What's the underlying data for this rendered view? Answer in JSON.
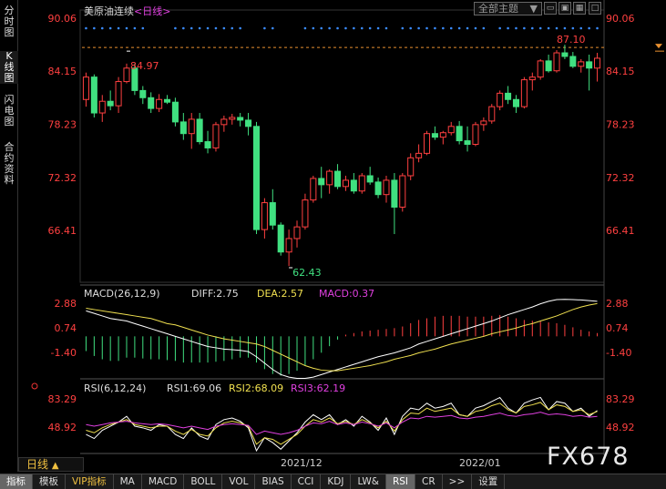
{
  "sidebar": {
    "tabs": [
      {
        "label": "分时图",
        "active": false
      },
      {
        "label": "K线图",
        "active": true
      },
      {
        "label": "闪电图",
        "active": false
      },
      {
        "label": "合约资料",
        "active": false
      }
    ]
  },
  "header": {
    "symbol": "美原油连续",
    "period_tag": "<日线>",
    "theme_select": "全部主题",
    "theme_arrow": "▼"
  },
  "price_axis": {
    "ticks": [
      "90.06",
      "84.15",
      "78.23",
      "72.32",
      "66.41"
    ]
  },
  "annotations": {
    "high_left": "84.97",
    "high_right": "87.10",
    "low": "62.43"
  },
  "macd": {
    "title": "MACD(26,12,9)",
    "diff": "DIFF:2.75",
    "dea": "DEA:2.57",
    "macd": "MACD:0.37",
    "ticks": [
      "2.88",
      "0.74",
      "-1.40"
    ]
  },
  "rsi": {
    "title": "RSI(6,12,24)",
    "rsi1": "RSI1:69.06",
    "rsi2": "RSI2:68.09",
    "rsi3": "RSI3:62.19",
    "ticks": [
      "83.29",
      "48.92"
    ]
  },
  "time_axis": [
    "2021/12",
    "2022/01"
  ],
  "period_box": {
    "label": "日线",
    "arrow": "▲"
  },
  "bottom_tabs": [
    {
      "label": "指标",
      "active": true
    },
    {
      "label": "模板",
      "active": false
    },
    {
      "label": "VIP指标",
      "active": false,
      "vip": true
    },
    {
      "label": "MA",
      "active": false
    },
    {
      "label": "MACD",
      "active": false
    },
    {
      "label": "BOLL",
      "active": false
    },
    {
      "label": "VOL",
      "active": false
    },
    {
      "label": "BIAS",
      "active": false
    },
    {
      "label": "CCI",
      "active": false
    },
    {
      "label": "KDJ",
      "active": false
    },
    {
      "label": "LW&",
      "active": false
    },
    {
      "label": "RSI",
      "active": true
    },
    {
      "label": "CR",
      "active": false
    },
    {
      "label": ">>",
      "active": false
    },
    {
      "label": "设置",
      "active": false
    }
  ],
  "watermark": "FX678",
  "colors": {
    "up": "#ff4040",
    "down": "#40e080",
    "diff_line": "#ffffff",
    "dea_line": "#f0e050",
    "macd_label": "#e040e0",
    "rsi3_line": "#e040e0",
    "axis_text": "#ff4040"
  },
  "candles": [
    [
      81.0,
      84.0,
      80.2,
      83.5
    ],
    [
      83.5,
      83.8,
      79.0,
      79.5
    ],
    [
      79.5,
      81.5,
      78.5,
      80.8
    ],
    [
      80.8,
      82.0,
      79.8,
      80.3
    ],
    [
      80.3,
      83.5,
      79.5,
      83.0
    ],
    [
      83.0,
      85.0,
      82.8,
      84.5
    ],
    [
      84.5,
      85.0,
      81.5,
      82.0
    ],
    [
      82.0,
      82.5,
      80.5,
      81.2
    ],
    [
      81.2,
      81.8,
      79.5,
      80.0
    ],
    [
      80.0,
      81.6,
      79.6,
      81.0
    ],
    [
      81.0,
      81.5,
      80.5,
      80.7
    ],
    [
      80.7,
      81.2,
      78.0,
      78.5
    ],
    [
      78.5,
      79.5,
      76.5,
      77.2
    ],
    [
      77.2,
      79.5,
      75.5,
      78.8
    ],
    [
      78.8,
      79.5,
      76.0,
      76.3
    ],
    [
      76.3,
      77.5,
      75.0,
      75.6
    ],
    [
      75.6,
      78.5,
      75.2,
      78.2
    ],
    [
      78.2,
      79.2,
      77.4,
      78.8
    ],
    [
      78.8,
      79.4,
      78.2,
      79.0
    ],
    [
      79.0,
      79.5,
      78.0,
      78.7
    ],
    [
      78.7,
      79.5,
      77.0,
      78.0
    ],
    [
      78.0,
      78.5,
      66.0,
      66.5
    ],
    [
      66.5,
      70.0,
      65.5,
      69.5
    ],
    [
      69.5,
      71.0,
      66.5,
      67.0
    ],
    [
      67.0,
      67.3,
      63.6,
      64.0
    ],
    [
      64.0,
      66.5,
      62.43,
      65.5
    ],
    [
      65.5,
      67.5,
      64.5,
      66.8
    ],
    [
      66.8,
      70.5,
      66.5,
      69.8
    ],
    [
      69.8,
      72.5,
      69.5,
      72.2
    ],
    [
      72.2,
      73.5,
      70.0,
      71.5
    ],
    [
      71.5,
      73.2,
      70.5,
      73.0
    ],
    [
      73.0,
      73.8,
      71.0,
      71.3
    ],
    [
      71.3,
      72.5,
      70.8,
      72.0
    ],
    [
      72.0,
      72.8,
      70.5,
      70.8
    ],
    [
      70.8,
      72.8,
      70.5,
      72.5
    ],
    [
      72.5,
      73.5,
      71.5,
      71.8
    ],
    [
      71.8,
      72.3,
      70.0,
      70.4
    ],
    [
      70.4,
      72.5,
      69.5,
      72.0
    ],
    [
      72.0,
      72.8,
      66.0,
      69.0
    ],
    [
      69.0,
      72.8,
      68.5,
      72.5
    ],
    [
      72.5,
      75.0,
      72.0,
      74.5
    ],
    [
      74.5,
      76.0,
      74.0,
      75.0
    ],
    [
      75.0,
      77.5,
      74.8,
      77.2
    ],
    [
      77.2,
      78.0,
      76.5,
      76.8
    ],
    [
      76.8,
      77.5,
      76.0,
      77.3
    ],
    [
      77.3,
      78.5,
      77.0,
      78.0
    ],
    [
      78.0,
      78.6,
      76.0,
      76.4
    ],
    [
      76.4,
      78.0,
      75.2,
      76.0
    ],
    [
      76.0,
      78.5,
      75.8,
      78.2
    ],
    [
      78.2,
      79.0,
      77.5,
      78.6
    ],
    [
      78.6,
      80.5,
      78.3,
      80.2
    ],
    [
      80.2,
      82.0,
      79.8,
      81.7
    ],
    [
      81.7,
      82.5,
      80.5,
      81.0
    ],
    [
      81.0,
      81.5,
      79.5,
      80.2
    ],
    [
      80.2,
      83.5,
      80.0,
      83.2
    ],
    [
      83.2,
      84.0,
      82.0,
      83.5
    ],
    [
      83.5,
      85.5,
      83.2,
      85.3
    ],
    [
      85.3,
      86.0,
      84.0,
      84.2
    ],
    [
      84.2,
      86.5,
      84.0,
      86.2
    ],
    [
      86.2,
      87.1,
      85.5,
      85.8
    ],
    [
      85.8,
      86.3,
      84.5,
      84.7
    ],
    [
      84.7,
      85.5,
      84.0,
      85.2
    ],
    [
      85.2,
      86.0,
      82.0,
      84.5
    ],
    [
      84.5,
      86.2,
      83.0,
      85.6
    ]
  ],
  "macd_hist": [
    -0.9,
    -1.2,
    -1.4,
    -1.5,
    -1.5,
    -1.3,
    -1.3,
    -1.35,
    -1.4,
    -1.4,
    -1.45,
    -1.5,
    -1.6,
    -1.6,
    -1.6,
    -1.6,
    -1.55,
    -1.5,
    -1.4,
    -1.3,
    -1.3,
    -1.6,
    -2.0,
    -2.3,
    -2.4,
    -2.3,
    -2.1,
    -1.8,
    -1.4,
    -1.0,
    -0.6,
    -0.2,
    0.1,
    0.2,
    0.3,
    0.35,
    0.4,
    0.45,
    0.5,
    0.6,
    0.8,
    1.0,
    1.1,
    1.2,
    1.25,
    1.25,
    1.25,
    1.2,
    1.2,
    1.2,
    1.25,
    1.3,
    1.2,
    1.1,
    1.0,
    0.95,
    0.9,
    0.85,
    0.8,
    0.7,
    0.55,
    0.4,
    0.3,
    0.2
  ],
  "macd_diff": [
    2.0,
    1.8,
    1.6,
    1.4,
    1.3,
    1.2,
    1.0,
    0.8,
    0.6,
    0.4,
    0.2,
    0.0,
    -0.2,
    -0.4,
    -0.6,
    -0.8,
    -0.9,
    -1.0,
    -1.05,
    -1.1,
    -1.2,
    -1.6,
    -2.1,
    -2.6,
    -3.0,
    -3.2,
    -3.3,
    -3.3,
    -3.2,
    -3.0,
    -2.8,
    -2.6,
    -2.4,
    -2.2,
    -2.0,
    -1.8,
    -1.6,
    -1.45,
    -1.3,
    -1.1,
    -0.9,
    -0.6,
    -0.4,
    -0.2,
    0.0,
    0.2,
    0.4,
    0.6,
    0.8,
    1.0,
    1.2,
    1.45,
    1.7,
    1.9,
    2.1,
    2.3,
    2.55,
    2.75,
    2.88,
    2.9,
    2.88,
    2.85,
    2.8,
    2.75
  ],
  "macd_dea": [
    2.2,
    2.1,
    2.0,
    1.9,
    1.8,
    1.7,
    1.6,
    1.5,
    1.4,
    1.2,
    1.0,
    0.9,
    0.7,
    0.5,
    0.3,
    0.1,
    -0.05,
    -0.2,
    -0.3,
    -0.4,
    -0.5,
    -0.6,
    -0.8,
    -1.1,
    -1.4,
    -1.7,
    -2.0,
    -2.3,
    -2.5,
    -2.65,
    -2.7,
    -2.7,
    -2.6,
    -2.5,
    -2.4,
    -2.3,
    -2.15,
    -2.0,
    -1.8,
    -1.65,
    -1.5,
    -1.3,
    -1.15,
    -1.0,
    -0.8,
    -0.6,
    -0.45,
    -0.3,
    -0.15,
    0.0,
    0.2,
    0.35,
    0.5,
    0.65,
    0.85,
    1.0,
    1.2,
    1.4,
    1.6,
    1.85,
    2.1,
    2.3,
    2.45,
    2.57
  ],
  "rsi1": [
    40,
    35,
    45,
    50,
    55,
    62,
    50,
    48,
    45,
    52,
    50,
    40,
    35,
    48,
    38,
    34,
    52,
    58,
    60,
    56,
    48,
    20,
    36,
    30,
    22,
    32,
    42,
    55,
    64,
    58,
    64,
    52,
    58,
    50,
    62,
    55,
    45,
    60,
    40,
    62,
    72,
    70,
    78,
    72,
    74,
    78,
    64,
    62,
    72,
    75,
    80,
    85,
    72,
    66,
    78,
    82,
    85,
    70,
    80,
    78,
    68,
    72,
    62,
    69
  ],
  "rsi2": [
    45,
    42,
    48,
    52,
    55,
    58,
    52,
    50,
    48,
    50,
    50,
    44,
    40,
    46,
    40,
    38,
    48,
    54,
    56,
    54,
    50,
    28,
    36,
    34,
    28,
    34,
    40,
    50,
    58,
    55,
    60,
    53,
    56,
    52,
    58,
    54,
    48,
    56,
    44,
    58,
    66,
    65,
    72,
    68,
    70,
    72,
    64,
    62,
    68,
    70,
    75,
    78,
    70,
    66,
    74,
    76,
    79,
    70,
    76,
    74,
    68,
    70,
    64,
    68
  ],
  "rsi3": [
    52,
    50,
    52,
    54,
    55,
    56,
    54,
    53,
    52,
    53,
    52,
    50,
    48,
    50,
    48,
    46,
    50,
    52,
    53,
    52,
    51,
    40,
    44,
    42,
    40,
    42,
    45,
    50,
    54,
    53,
    56,
    52,
    54,
    52,
    55,
    53,
    50,
    54,
    48,
    55,
    60,
    59,
    62,
    61,
    62,
    63,
    60,
    59,
    61,
    62,
    64,
    66,
    63,
    62,
    64,
    65,
    67,
    64,
    65,
    64,
    62,
    63,
    61,
    62
  ]
}
